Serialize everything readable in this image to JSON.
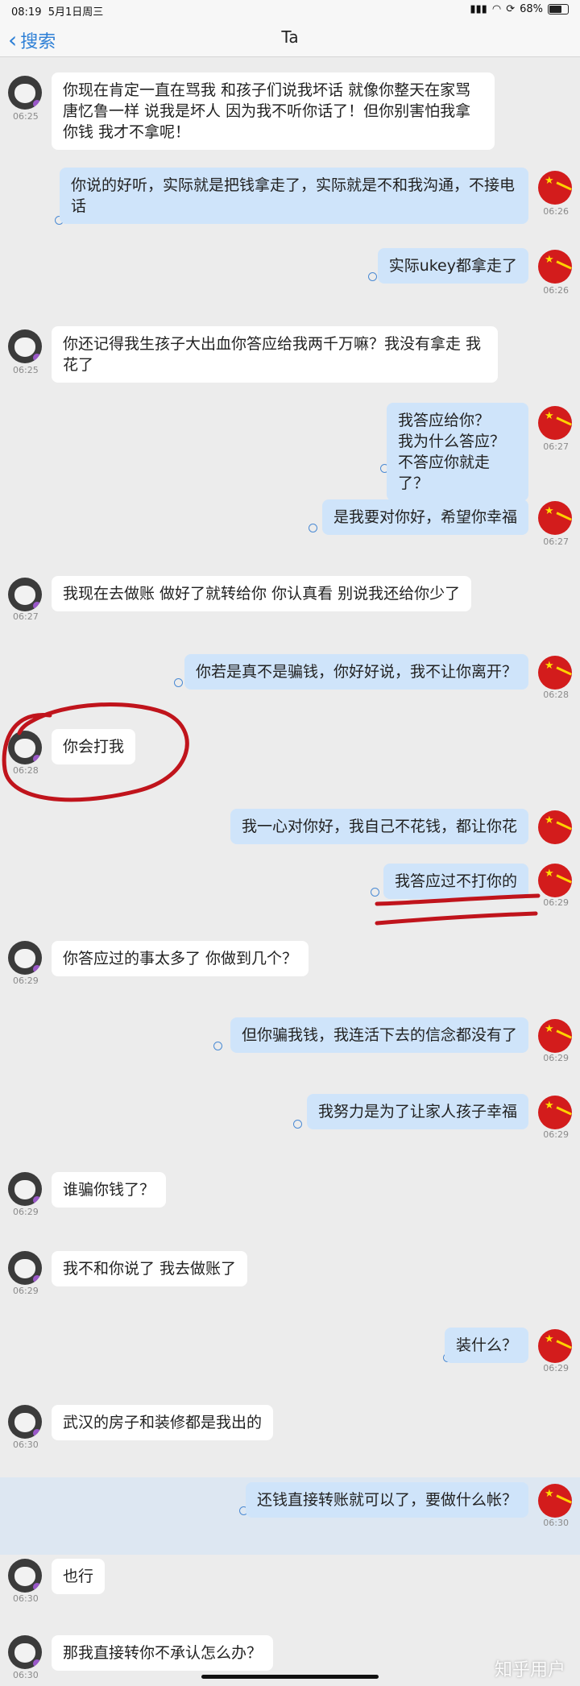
{
  "status": {
    "time": "08:19",
    "date": "5月1日周三",
    "battery": "68%"
  },
  "nav": {
    "back_label": "搜索",
    "title": "Ta"
  },
  "messages": [
    {
      "time": "06:25",
      "text": "你现在肯定一直在骂我 和孩子们说我坏话 就像你整天在家骂唐忆鲁一样 说我是坏人 因为我不听你话了！但你别害怕我拿你钱 我才不拿呢！"
    },
    {
      "time": "06:26",
      "text": "你说的好听，实际就是把钱拿走了，实际就是不和我沟通，不接电话"
    },
    {
      "time": "06:26",
      "text": "实际ukey都拿走了"
    },
    {
      "time": "06:25",
      "text": "你还记得我生孩子大出血你答应给我两千万嘛？我没有拿走 我花了"
    },
    {
      "time": "06:27",
      "lines": [
        "我答应给你？",
        "我为什么答应？",
        "不答应你就走了？"
      ]
    },
    {
      "time": "06:27",
      "text": "是我要对你好，希望你幸福"
    },
    {
      "time": "06:27",
      "text": "我现在去做账 做好了就转给你 你认真看 别说我还给你少了"
    },
    {
      "time": "06:28",
      "text": "你若是真不是骗钱，你好好说，我不让你离开？"
    },
    {
      "time": "06:28",
      "text": "你会打我"
    },
    {
      "time": "",
      "text": "我一心对你好，我自己不花钱，都让你花"
    },
    {
      "time": "06:29",
      "text": "我答应过不打你的"
    },
    {
      "time": "06:29",
      "text": "你答应过的事太多了 你做到几个？"
    },
    {
      "time": "06:29",
      "text": "但你骗我钱，我连活下去的信念都没有了"
    },
    {
      "time": "06:29",
      "text": "我努力是为了让家人孩子幸福"
    },
    {
      "time": "06:29",
      "text": "谁骗你钱了？"
    },
    {
      "time": "06:29",
      "text": "我不和你说了 我去做账了"
    },
    {
      "time": "06:29",
      "text": "装什么？"
    },
    {
      "time": "06:30",
      "text": "武汉的房子和装修都是我出的"
    },
    {
      "time": "06:30",
      "text": "还钱直接转账就可以了，要做什么帐？"
    },
    {
      "time": "06:30",
      "text": "也行"
    },
    {
      "time": "06:30",
      "text": "那我直接转你不承认怎么办？"
    }
  ],
  "watermark": "知乎用户",
  "colors": {
    "incoming": "#ffffff",
    "outgoing": "#cfe4fa",
    "background": "#ececec",
    "annotation": "#c0141c"
  }
}
